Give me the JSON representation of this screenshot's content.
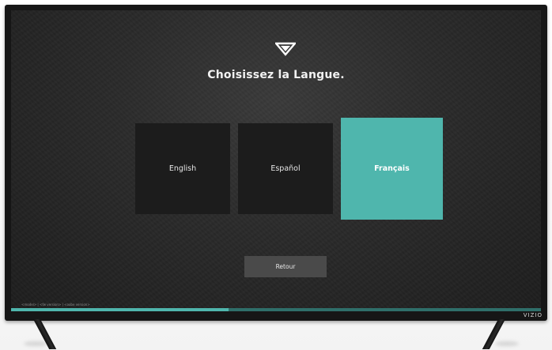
{
  "setup": {
    "title": "Choisissez la Langue.",
    "logo_icon": "vizio-v-icon",
    "languages": [
      {
        "label": "English",
        "selected": false
      },
      {
        "label": "Español",
        "selected": false
      },
      {
        "label": "Français",
        "selected": true
      }
    ],
    "back_label": "Retour",
    "version_info": "<model>  |  <fw version>  |  <oobe version>",
    "progress_fraction": 0.41
  },
  "tv": {
    "brand": "VIZIO"
  },
  "colors": {
    "accent": "#4fb6ad",
    "tile_dark": "#1c1c1c",
    "button": "#4a4a4a",
    "progress_track": "#2f6f6a"
  }
}
